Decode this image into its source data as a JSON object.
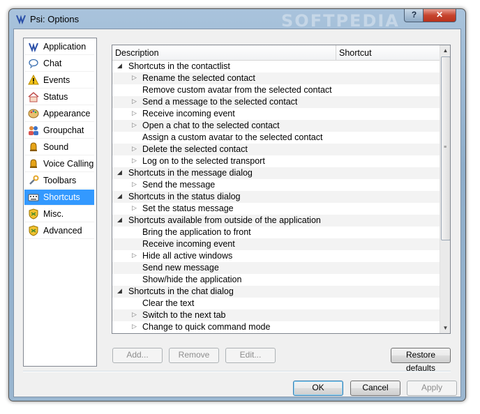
{
  "window": {
    "title": "Psi: Options",
    "watermark": "SOFTPEDIA",
    "help_label": "?",
    "close_label": "✕"
  },
  "sidebar": {
    "items": [
      {
        "label": "Application",
        "icon": "psi-logo-icon",
        "selected": false
      },
      {
        "label": "Chat",
        "icon": "chat-bubble-icon",
        "selected": false
      },
      {
        "label": "Events",
        "icon": "warning-icon",
        "selected": false
      },
      {
        "label": "Status",
        "icon": "home-icon",
        "selected": false
      },
      {
        "label": "Appearance",
        "icon": "palette-icon",
        "selected": false
      },
      {
        "label": "Groupchat",
        "icon": "users-icon",
        "selected": false
      },
      {
        "label": "Sound",
        "icon": "bell-icon",
        "selected": false
      },
      {
        "label": "Voice Calling",
        "icon": "bell-icon",
        "selected": false
      },
      {
        "label": "Toolbars",
        "icon": "wrench-icon",
        "selected": false
      },
      {
        "label": "Shortcuts",
        "icon": "keyboard-icon",
        "selected": true
      },
      {
        "label": "Misc.",
        "icon": "shield-icon",
        "selected": false
      },
      {
        "label": "Advanced",
        "icon": "shield-icon",
        "selected": false
      }
    ]
  },
  "shortcuts": {
    "columns": {
      "description": "Description",
      "shortcut": "Shortcut"
    },
    "rows": [
      {
        "level": 0,
        "expander": "expanded",
        "text": "Shortcuts in the contactlist"
      },
      {
        "level": 1,
        "expander": "collapsed",
        "text": "Rename the selected contact"
      },
      {
        "level": 1,
        "expander": "none",
        "text": "Remove custom avatar from the selected contact"
      },
      {
        "level": 1,
        "expander": "collapsed",
        "text": "Send a message to the selected contact"
      },
      {
        "level": 1,
        "expander": "collapsed",
        "text": "Receive incoming event"
      },
      {
        "level": 1,
        "expander": "collapsed",
        "text": "Open a chat to the selected contact"
      },
      {
        "level": 1,
        "expander": "none",
        "text": "Assign a custom avatar to the selected contact"
      },
      {
        "level": 1,
        "expander": "collapsed",
        "text": "Delete the selected contact"
      },
      {
        "level": 1,
        "expander": "collapsed",
        "text": "Log on to the selected transport"
      },
      {
        "level": 0,
        "expander": "expanded",
        "text": "Shortcuts in the message dialog"
      },
      {
        "level": 1,
        "expander": "collapsed",
        "text": "Send the message"
      },
      {
        "level": 0,
        "expander": "expanded",
        "text": "Shortcuts in the status dialog"
      },
      {
        "level": 1,
        "expander": "collapsed",
        "text": "Set the status message"
      },
      {
        "level": 0,
        "expander": "expanded",
        "text": "Shortcuts available from outside of the application"
      },
      {
        "level": 1,
        "expander": "none",
        "text": "Bring the application to front"
      },
      {
        "level": 1,
        "expander": "none",
        "text": "Receive incoming event"
      },
      {
        "level": 1,
        "expander": "collapsed",
        "text": "Hide all active windows"
      },
      {
        "level": 1,
        "expander": "none",
        "text": "Send new message"
      },
      {
        "level": 1,
        "expander": "none",
        "text": "Show/hide the application"
      },
      {
        "level": 0,
        "expander": "expanded",
        "text": "Shortcuts in the chat dialog"
      },
      {
        "level": 1,
        "expander": "none",
        "text": "Clear the text"
      },
      {
        "level": 1,
        "expander": "collapsed",
        "text": "Switch to the next tab"
      },
      {
        "level": 1,
        "expander": "collapsed",
        "text": "Change to quick command mode"
      }
    ]
  },
  "actions": {
    "add": "Add...",
    "remove": "Remove",
    "edit": "Edit...",
    "restore": "Restore defaults"
  },
  "footer": {
    "ok": "OK",
    "cancel": "Cancel",
    "apply": "Apply"
  },
  "colors": {
    "selection": "#3399ff",
    "frame": "#9ab6d0"
  }
}
